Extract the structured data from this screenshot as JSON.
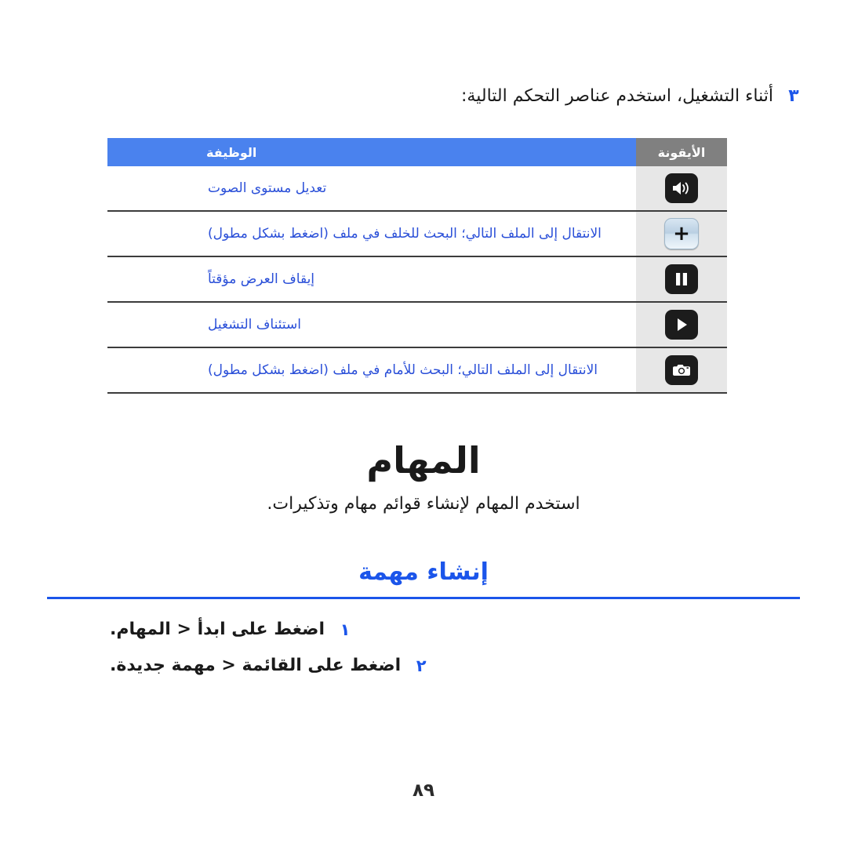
{
  "intro": {
    "number": "٣",
    "text": "أثناء التشغيل، استخدم عناصر التحكم التالية:"
  },
  "controls_table": {
    "headers": {
      "icon": "الأيقونة",
      "function": "الوظيفة"
    },
    "rows": [
      {
        "icon": "speaker-volume-icon",
        "function": "تعديل مستوى الصوت"
      },
      {
        "icon": "plus-button-icon",
        "function": "الانتقال إلى الملف التالي؛ البحث للخلف في ملف (اضغط بشكل مطول)"
      },
      {
        "icon": "pause-icon",
        "function": "إيقاف العرض مؤقتاً"
      },
      {
        "icon": "play-icon",
        "function": "استئناف التشغيل"
      },
      {
        "icon": "camera-icon",
        "function": "الانتقال إلى الملف التالي؛ البحث للأمام في ملف (اضغط بشكل مطول)"
      }
    ]
  },
  "section": {
    "title": "المهام",
    "description": "استخدم المهام لإنشاء قوائم مهام وتذكيرات."
  },
  "subsection": {
    "title": "إنشاء مهمة",
    "steps": [
      {
        "number": "١",
        "text": "اضغط على ابدأ < المهام."
      },
      {
        "number": "٢",
        "text": "اضغط على القائمة < مهمة جديدة."
      }
    ]
  },
  "footer": {
    "page_number": "٨٩"
  },
  "colors": {
    "accent_blue": "#1b55ea",
    "header_blue": "#4a82ee",
    "header_gray": "#808080",
    "link_blue": "#2a4fd8",
    "icon_cell_bg": "#e7e7e7"
  }
}
